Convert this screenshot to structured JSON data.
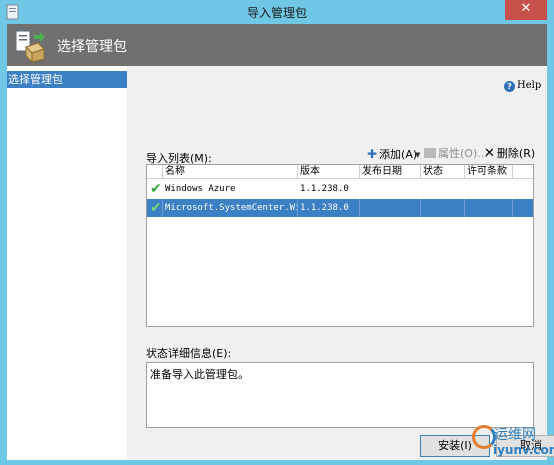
{
  "window": {
    "title": "导入管理包",
    "close_glyph": "✕"
  },
  "header": {
    "title": "选择管理包",
    "icon": "package-install-icon"
  },
  "nav": {
    "items": [
      {
        "label": "选择管理包",
        "selected": true
      }
    ]
  },
  "help": {
    "label": "Help",
    "icon": "help-icon"
  },
  "import_list": {
    "label": "导入列表(M):",
    "toolbar": {
      "add_label": "添加(A)",
      "properties_label": "属性(O)...",
      "delete_label": "删除(R)"
    },
    "columns": [
      "名称",
      "版本",
      "发布日期",
      "状态",
      "许可条款"
    ],
    "rows": [
      {
        "name": "Windows Azure",
        "version": "1.1.238.0",
        "date": "",
        "status": "",
        "license": "",
        "selected": false
      },
      {
        "name": "Microsoft.SystemCenter.Win...",
        "version": "1.1.238.0",
        "date": "",
        "status": "",
        "license": "",
        "selected": true
      }
    ]
  },
  "status_details": {
    "label": "状态详细信息(E):",
    "value": "准备导入此管理包。"
  },
  "buttons": {
    "install_label": "安装(I)",
    "cancel_label": "取消"
  },
  "watermark": {
    "line1": "运维网",
    "line2": "iyunv.com"
  },
  "colors": {
    "titlebar": "#6fc7e6",
    "header": "#707070",
    "selection": "#3b7fc4",
    "close": "#c7504a"
  }
}
